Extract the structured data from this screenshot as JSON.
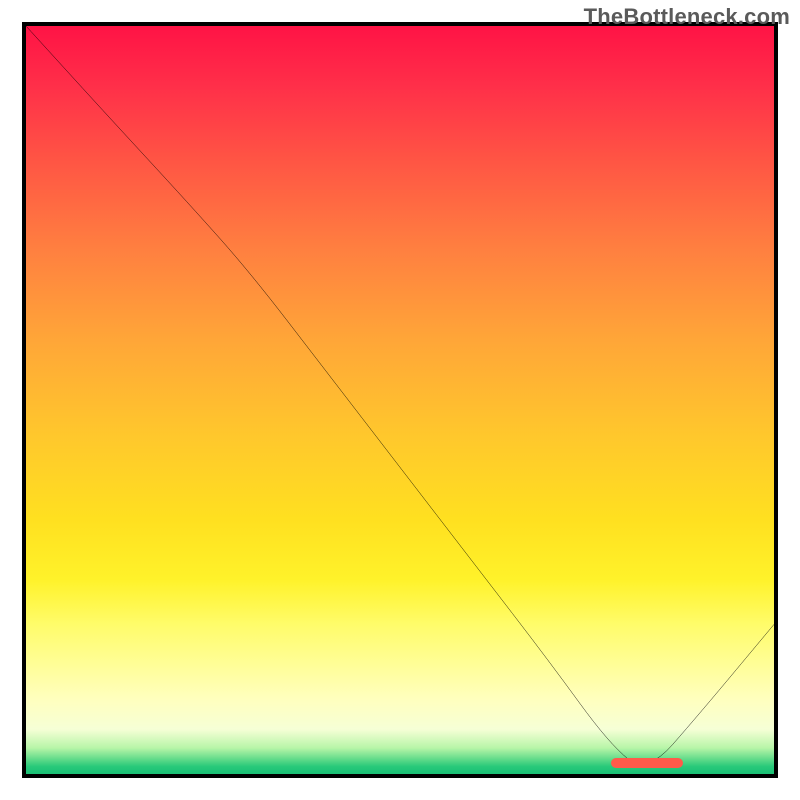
{
  "watermark": "TheBottleneck.com",
  "chart_data": {
    "type": "line",
    "title": "",
    "xlabel": "",
    "ylabel": "",
    "xlim": [
      0,
      100
    ],
    "ylim": [
      0,
      100
    ],
    "grid": false,
    "note": "Axes are unlabelled; values estimated from normalized 0-100 coords of plot interior. Curve depicts bottleneck severity; minimum (optimal) near x≈83.",
    "series": [
      {
        "name": "bottleneck-curve",
        "x": [
          0,
          10,
          22,
          30,
          40,
          50,
          60,
          70,
          78,
          83,
          90,
          100
        ],
        "values": [
          100,
          89,
          76,
          67,
          54,
          41,
          28,
          15,
          4,
          0,
          8,
          20
        ]
      }
    ],
    "marker": {
      "name": "optimal-point",
      "x": 83,
      "y": 1.5,
      "color": "#ff5a4a"
    },
    "background_gradient_colors": {
      "top": "#ff1345",
      "mid": "#ffe020",
      "bottom": "#1ac075"
    }
  }
}
